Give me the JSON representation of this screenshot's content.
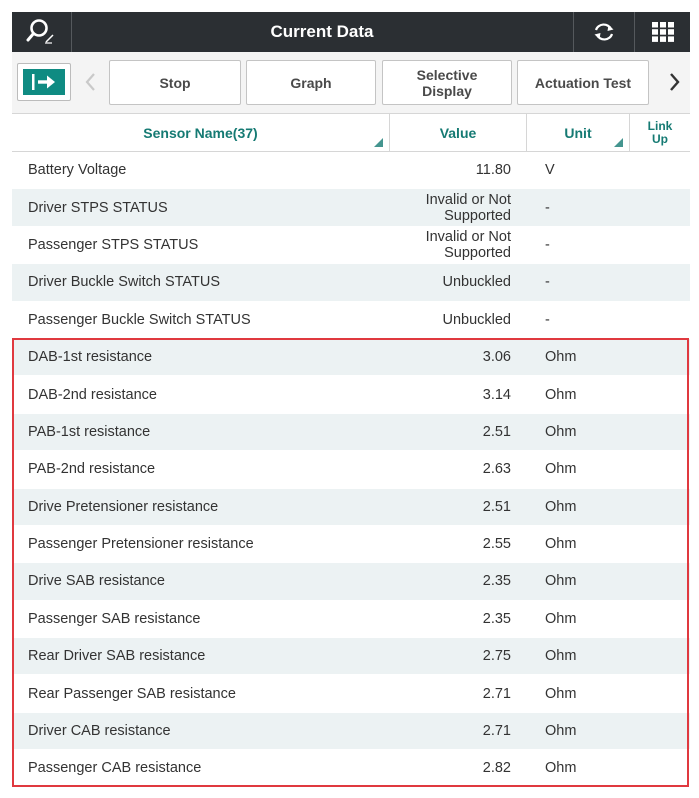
{
  "titlebar": {
    "title": "Current Data",
    "search_icon": "search-edit-icon",
    "refresh_icon": "refresh-icon",
    "menu_icon": "grid-menu-icon"
  },
  "toolbar": {
    "exit_icon": "exit-arrow-icon",
    "stop_label": "Stop",
    "graph_label": "Graph",
    "selective_label": "Selective\nDisplay",
    "actuation_label": "Actuation Test",
    "prev_icon": "chevron-left-icon",
    "next_icon": "chevron-right-icon"
  },
  "table": {
    "headers": {
      "name": "Sensor Name(37)",
      "value": "Value",
      "unit": "Unit",
      "link": "Link\nUp"
    },
    "rows": [
      {
        "name": "Battery Voltage",
        "value": "11.80",
        "unit": "V"
      },
      {
        "name": "Driver STPS STATUS",
        "value": "Invalid or Not\nSupported",
        "unit": "-"
      },
      {
        "name": "Passenger STPS STATUS",
        "value": "Invalid or Not\nSupported",
        "unit": "-"
      },
      {
        "name": "Driver Buckle Switch STATUS",
        "value": "Unbuckled",
        "unit": "-"
      },
      {
        "name": "Passenger Buckle Switch STATUS",
        "value": "Unbuckled",
        "unit": "-"
      },
      {
        "name": "DAB-1st resistance",
        "value": "3.06",
        "unit": "Ohm"
      },
      {
        "name": "DAB-2nd resistance",
        "value": "3.14",
        "unit": "Ohm"
      },
      {
        "name": "PAB-1st resistance",
        "value": "2.51",
        "unit": "Ohm"
      },
      {
        "name": "PAB-2nd resistance",
        "value": "2.63",
        "unit": "Ohm"
      },
      {
        "name": "Drive Pretensioner resistance",
        "value": "2.51",
        "unit": "Ohm"
      },
      {
        "name": "Passenger Pretensioner resistance",
        "value": "2.55",
        "unit": "Ohm"
      },
      {
        "name": "Drive SAB resistance",
        "value": "2.35",
        "unit": "Ohm"
      },
      {
        "name": "Passenger SAB resistance",
        "value": "2.35",
        "unit": "Ohm"
      },
      {
        "name": "Rear Driver SAB resistance",
        "value": "2.75",
        "unit": "Ohm"
      },
      {
        "name": "Rear Passenger SAB resistance",
        "value": "2.71",
        "unit": "Ohm"
      },
      {
        "name": "Driver CAB resistance",
        "value": "2.71",
        "unit": "Ohm"
      },
      {
        "name": "Passenger CAB resistance",
        "value": "2.82",
        "unit": "Ohm"
      }
    ]
  },
  "colors": {
    "accent": "#0f8b82",
    "header_text": "#157a73",
    "titlebar": "#2b2f33",
    "highlight": "#e0393f",
    "row_alt": "#ecf2f3"
  }
}
